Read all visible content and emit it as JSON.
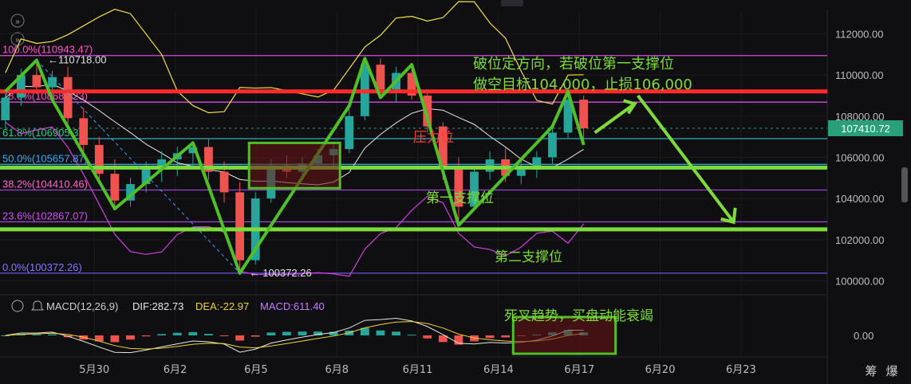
{
  "toolbar": {
    "nav_arrow_up": "»",
    "nav_arrow_down": "»"
  },
  "chart_data": {
    "type": "candlestick",
    "instrument_price_axis": {
      "ticks": [
        "112000.00",
        "110000.00",
        "108000.00",
        "106000.00",
        "104000.00",
        "102000.00",
        "100000.00"
      ],
      "tick_values": [
        112000,
        110000,
        108000,
        106000,
        104000,
        102000,
        100000
      ],
      "ylim": [
        99400,
        113100
      ],
      "current_price_label": "107410.72",
      "current_price": 107410.72
    },
    "x_axis": {
      "ticks": [
        "5月30",
        "6月2",
        "6月5",
        "6月8",
        "6月11",
        "6月14",
        "6月17",
        "6月20",
        "6月23"
      ],
      "tick_positions_in_days": [
        1,
        4,
        7,
        10,
        13,
        16,
        19,
        22,
        25
      ],
      "domain_days": [
        -2.5,
        28.2
      ]
    },
    "fib_levels": [
      {
        "label": "100.0%(110943.47)",
        "value": 110943.47,
        "color": "#ff55cc",
        "line": "#d54ce0"
      },
      {
        "label": "78.6%(108681.23)",
        "value": 108681.23,
        "color": "#ff55cc",
        "line": "#d54ce0"
      },
      {
        "label": "61.8%(106905.32)",
        "value": 106905.32,
        "color": "#33cc88",
        "line": "#2aa0a8"
      },
      {
        "label": "50.0%(105657.87)",
        "value": 105657.87,
        "color": "#33aaee",
        "line": "#33a0e0"
      },
      {
        "label": "38.2%(104410.46)",
        "value": 104410.46,
        "color": "#ff66cc",
        "line": "#a040d0"
      },
      {
        "label": "23.6%(102867.07)",
        "value": 102867.07,
        "color": "#cc55ee",
        "line": "#a040d0"
      },
      {
        "label": "0.0%(100372.26)",
        "value": 100372.26,
        "color": "#8877ff",
        "line": "#6e50e0"
      }
    ],
    "marked_high": {
      "label": "110718.00",
      "value": 110718.0
    },
    "marked_low": {
      "label": "100372.26",
      "value": 100372.26
    },
    "resistance_line": {
      "value": 109200
    },
    "support_line_1": {
      "value": 105500
    },
    "support_line_2": {
      "value": 102500
    },
    "candles": [
      {
        "o": 107800,
        "h": 109200,
        "l": 107400,
        "c": 108900
      },
      {
        "o": 108900,
        "h": 110300,
        "l": 108500,
        "c": 110000
      },
      {
        "o": 110000,
        "h": 110718,
        "l": 109100,
        "c": 109400
      },
      {
        "o": 109400,
        "h": 110200,
        "l": 108800,
        "c": 109900
      },
      {
        "o": 109900,
        "h": 110400,
        "l": 107600,
        "c": 107900
      },
      {
        "o": 107900,
        "h": 108400,
        "l": 106200,
        "c": 106600
      },
      {
        "o": 106600,
        "h": 107000,
        "l": 104700,
        "c": 105200
      },
      {
        "o": 105200,
        "h": 105900,
        "l": 103500,
        "c": 103900
      },
      {
        "o": 103900,
        "h": 105000,
        "l": 103600,
        "c": 104700
      },
      {
        "o": 104700,
        "h": 105800,
        "l": 104300,
        "c": 105500
      },
      {
        "o": 105500,
        "h": 106300,
        "l": 104800,
        "c": 105900
      },
      {
        "o": 105900,
        "h": 106500,
        "l": 105100,
        "c": 106200
      },
      {
        "o": 106200,
        "h": 106700,
        "l": 105600,
        "c": 106500
      },
      {
        "o": 106500,
        "h": 106900,
        "l": 104900,
        "c": 105300
      },
      {
        "o": 105300,
        "h": 105800,
        "l": 103800,
        "c": 104300
      },
      {
        "o": 104300,
        "h": 104800,
        "l": 100372,
        "c": 101000
      },
      {
        "o": 101000,
        "h": 104300,
        "l": 100800,
        "c": 104000
      },
      {
        "o": 104000,
        "h": 105900,
        "l": 103800,
        "c": 105600
      },
      {
        "o": 105600,
        "h": 106100,
        "l": 105000,
        "c": 105300
      },
      {
        "o": 105300,
        "h": 106000,
        "l": 105000,
        "c": 105700
      },
      {
        "o": 105700,
        "h": 106400,
        "l": 105400,
        "c": 106100
      },
      {
        "o": 106100,
        "h": 106700,
        "l": 105600,
        "c": 106400
      },
      {
        "o": 106400,
        "h": 108500,
        "l": 106200,
        "c": 108000
      },
      {
        "o": 108000,
        "h": 110800,
        "l": 107800,
        "c": 110500
      },
      {
        "o": 110500,
        "h": 110800,
        "l": 108900,
        "c": 109300
      },
      {
        "o": 109300,
        "h": 110400,
        "l": 108700,
        "c": 110100
      },
      {
        "o": 110100,
        "h": 110500,
        "l": 108800,
        "c": 109000
      },
      {
        "o": 109000,
        "h": 109300,
        "l": 107200,
        "c": 107500
      },
      {
        "o": 107500,
        "h": 107700,
        "l": 104900,
        "c": 105500
      },
      {
        "o": 105500,
        "h": 106000,
        "l": 102700,
        "c": 103600
      },
      {
        "o": 103600,
        "h": 105600,
        "l": 103400,
        "c": 105300
      },
      {
        "o": 105300,
        "h": 106300,
        "l": 104900,
        "c": 105900
      },
      {
        "o": 105900,
        "h": 106500,
        "l": 104800,
        "c": 105100
      },
      {
        "o": 105100,
        "h": 105900,
        "l": 104700,
        "c": 105400
      },
      {
        "o": 105400,
        "h": 106300,
        "l": 105000,
        "c": 106000
      },
      {
        "o": 106000,
        "h": 107500,
        "l": 105700,
        "c": 107200
      },
      {
        "o": 107200,
        "h": 109200,
        "l": 106900,
        "c": 108800
      },
      {
        "o": 108800,
        "h": 109000,
        "l": 106600,
        "c": 107410
      }
    ],
    "candle_start_day": -2.3,
    "candle_step_days": 0.58,
    "annotations": [
      {
        "text": "破位定方向，若破位第一支撑位",
        "color": "#7ddc3c"
      },
      {
        "text": "做空目标104,000，止损106,000",
        "color": "#7ddc3c"
      },
      {
        "text": "压力位",
        "color": "#ff3b30"
      },
      {
        "text": "第一支撑位",
        "color": "#7ddc3c"
      },
      {
        "text": "第二支撑位",
        "color": "#7ddc3c"
      },
      {
        "text": "死叉趋势，买盘动能衰竭",
        "color": "#7ddc3c"
      }
    ],
    "macd": {
      "label": "MACD(12,26,9)",
      "dif_label": "DIF:282.73",
      "dea_label": "DEA:-22.97",
      "macd_label": "MACD:611.40",
      "axis_tick": "0.00",
      "dif": 282.73,
      "dea": -22.97,
      "macd": 611.4
    },
    "colors": {
      "up": "#26a69a",
      "down": "#ef5350",
      "resistance": "#ff2a2a",
      "support": "#7ddc3c",
      "price_tag": "#2aa07a"
    },
    "bottom_right_labels": [
      "筹",
      "爆"
    ]
  }
}
